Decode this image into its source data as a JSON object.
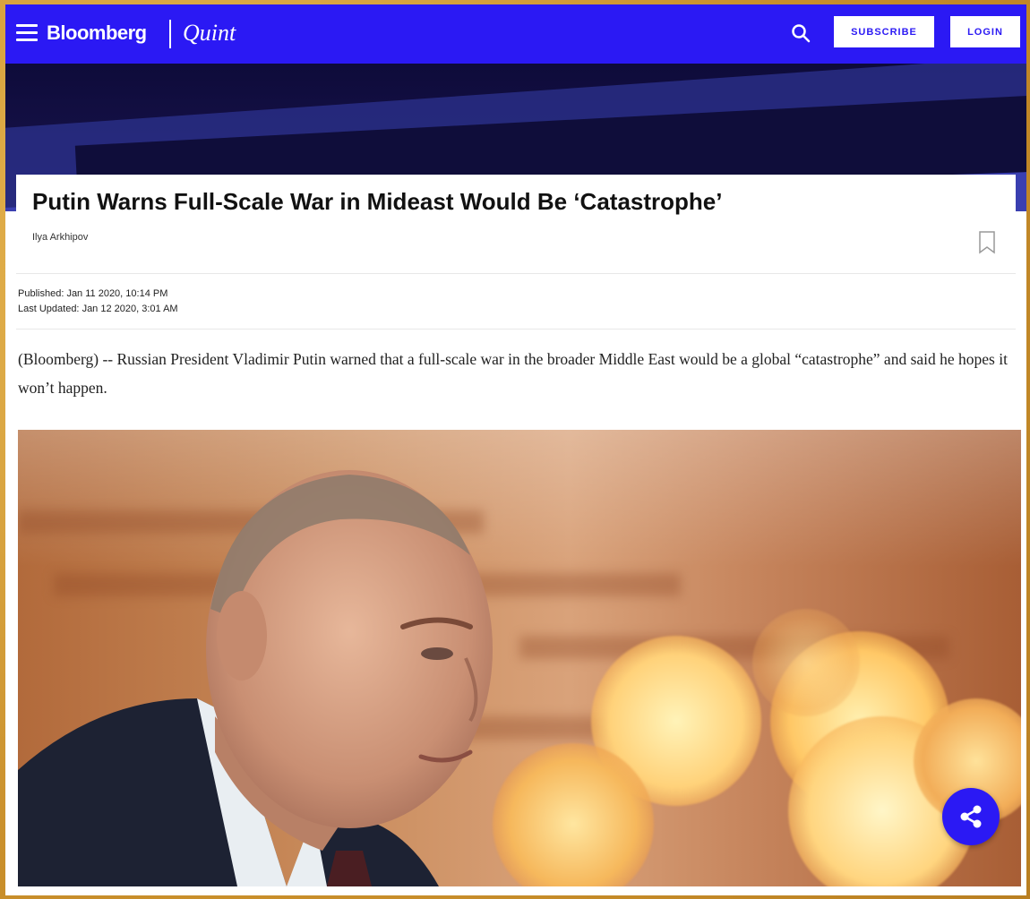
{
  "header": {
    "brand": "Bloomberg",
    "brand_sub": "Quint",
    "subscribe_label": "SUBSCRIBE",
    "login_label": "LOGIN",
    "accent_color": "#2b19f4"
  },
  "article": {
    "title": "Putin Warns Full-Scale War in Mideast Would Be ‘Catastrophe’",
    "author": "Ilya Arkhipov",
    "published_label": "Published:",
    "published_value": "Jan 11 2020, 10:14 PM",
    "updated_label": "Last Updated:",
    "updated_value": "Jan 12 2020, 3:01 AM",
    "lede": "(Bloomberg) -- Russian President Vladimir Putin warned that a full-scale war in the broader Middle East would be a global “catastrophe” and said he hopes it won’t happen."
  },
  "icons": {
    "menu": "hamburger-icon",
    "search": "search-icon",
    "bookmark": "bookmark-icon",
    "share": "share-icon"
  }
}
